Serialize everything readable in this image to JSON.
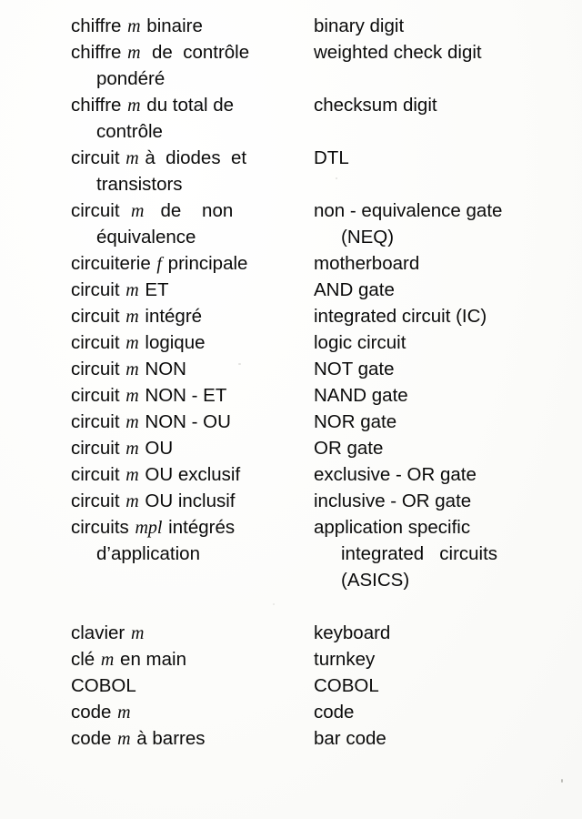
{
  "document": {
    "type": "bilingual-dictionary-page",
    "source_language": "French",
    "target_language": "English",
    "section_letter_range": "chiffre – code"
  },
  "entries": [
    {
      "fr_lines": [
        {
          "text": "chiffre ",
          "gender": "m",
          "after": " binaire",
          "indent": 0,
          "justify": false
        }
      ],
      "en_lines": [
        {
          "text": "binary digit",
          "indent": 0,
          "justify": false
        }
      ]
    },
    {
      "fr_lines": [
        {
          "text": "chiffre ",
          "gender": "m",
          "after": "  de  contrôle",
          "indent": 0,
          "justify": true
        },
        {
          "text": "pondéré",
          "indent": 1,
          "justify": false
        }
      ],
      "en_lines": [
        {
          "text": "weighted check digit",
          "indent": 0,
          "justify": false
        }
      ]
    },
    {
      "fr_lines": [
        {
          "text": "chiffre ",
          "gender": "m",
          "after": " du total de",
          "indent": 0,
          "justify": true
        },
        {
          "text": "contrôle",
          "indent": 1,
          "justify": false
        }
      ],
      "en_lines": [
        {
          "text": "checksum digit",
          "indent": 0,
          "justify": false
        }
      ]
    },
    {
      "fr_lines": [
        {
          "text": "circuit ",
          "gender": "m",
          "after": " à  diodes  et",
          "indent": 0,
          "justify": true
        },
        {
          "text": "transistors",
          "indent": 1,
          "justify": false
        }
      ],
      "en_lines": [
        {
          "text": "DTL",
          "indent": 0,
          "justify": false
        }
      ]
    },
    {
      "fr_lines": [
        {
          "text": "circuit  ",
          "gender": "m",
          "after": "   de    non",
          "indent": 0,
          "justify": true
        },
        {
          "text": "équivalence",
          "indent": 1,
          "justify": false
        }
      ],
      "en_lines": [
        {
          "text": "non - equivalence gate",
          "indent": 0,
          "justify": false
        },
        {
          "text": "(NEQ)",
          "indent": 2,
          "justify": false
        }
      ]
    },
    {
      "fr_lines": [
        {
          "text": "circuiterie ",
          "gender": "f",
          "after": " principale",
          "indent": 0,
          "justify": false
        }
      ],
      "en_lines": [
        {
          "text": "motherboard",
          "indent": 0,
          "justify": false
        }
      ]
    },
    {
      "fr_lines": [
        {
          "text": "circuit ",
          "gender": "m",
          "after": " ET",
          "indent": 0,
          "justify": false
        }
      ],
      "en_lines": [
        {
          "text": "AND gate",
          "indent": 0,
          "justify": false
        }
      ]
    },
    {
      "fr_lines": [
        {
          "text": "circuit ",
          "gender": "m",
          "after": " intégré",
          "indent": 0,
          "justify": false
        }
      ],
      "en_lines": [
        {
          "text": "integrated circuit (IC)",
          "indent": 0,
          "justify": false
        }
      ]
    },
    {
      "fr_lines": [
        {
          "text": "circuit ",
          "gender": "m",
          "after": " logique",
          "indent": 0,
          "justify": false
        }
      ],
      "en_lines": [
        {
          "text": "logic circuit",
          "indent": 0,
          "justify": false
        }
      ]
    },
    {
      "fr_lines": [
        {
          "text": "circuit ",
          "gender": "m",
          "after": " NON",
          "indent": 0,
          "justify": false
        }
      ],
      "en_lines": [
        {
          "text": "NOT gate",
          "indent": 0,
          "justify": false
        }
      ]
    },
    {
      "fr_lines": [
        {
          "text": "circuit ",
          "gender": "m",
          "after": " NON - ET",
          "indent": 0,
          "justify": false
        }
      ],
      "en_lines": [
        {
          "text": "NAND gate",
          "indent": 0,
          "justify": false
        }
      ]
    },
    {
      "fr_lines": [
        {
          "text": "circuit ",
          "gender": "m",
          "after": " NON - OU",
          "indent": 0,
          "justify": false
        }
      ],
      "en_lines": [
        {
          "text": "NOR gate",
          "indent": 0,
          "justify": false
        }
      ]
    },
    {
      "fr_lines": [
        {
          "text": "circuit ",
          "gender": "m",
          "after": " OU",
          "indent": 0,
          "justify": false
        }
      ],
      "en_lines": [
        {
          "text": "OR gate",
          "indent": 0,
          "justify": false
        }
      ]
    },
    {
      "fr_lines": [
        {
          "text": "circuit ",
          "gender": "m",
          "after": " OU exclusif",
          "indent": 0,
          "justify": false
        }
      ],
      "en_lines": [
        {
          "text": "exclusive - OR gate",
          "indent": 0,
          "justify": false
        }
      ]
    },
    {
      "fr_lines": [
        {
          "text": "circuit ",
          "gender": "m",
          "after": " OU inclusif",
          "indent": 0,
          "justify": false
        }
      ],
      "en_lines": [
        {
          "text": "inclusive - OR gate",
          "indent": 0,
          "justify": false
        }
      ]
    },
    {
      "fr_lines": [
        {
          "text": "circuits ",
          "gender": "mpl",
          "after": " intégrés",
          "indent": 0,
          "justify": true
        },
        {
          "text": "d’application",
          "indent": 1,
          "justify": false
        }
      ],
      "en_lines": [
        {
          "text": "application specific",
          "indent": 0,
          "justify": false
        },
        {
          "text": "integrated   circuits",
          "indent": 2,
          "justify": true
        },
        {
          "text": "(ASICS)",
          "indent": 2,
          "justify": false
        }
      ]
    },
    {
      "fr_lines": [
        {
          "text": "clavier ",
          "gender": "m",
          "after": "",
          "indent": 0,
          "justify": false
        }
      ],
      "en_lines": [
        {
          "text": "keyboard",
          "indent": 0,
          "justify": false
        }
      ],
      "gap_before": true
    },
    {
      "fr_lines": [
        {
          "text": "clé ",
          "gender": "m",
          "after": " en main",
          "indent": 0,
          "justify": false
        }
      ],
      "en_lines": [
        {
          "text": "turnkey",
          "indent": 0,
          "justify": false
        }
      ]
    },
    {
      "fr_lines": [
        {
          "text": "COBOL",
          "gender": "",
          "after": "",
          "indent": 0,
          "justify": false
        }
      ],
      "en_lines": [
        {
          "text": "COBOL",
          "indent": 0,
          "justify": false
        }
      ]
    },
    {
      "fr_lines": [
        {
          "text": "code ",
          "gender": "m",
          "after": "",
          "indent": 0,
          "justify": false
        }
      ],
      "en_lines": [
        {
          "text": "code",
          "indent": 0,
          "justify": false
        }
      ]
    },
    {
      "fr_lines": [
        {
          "text": "code ",
          "gender": "m",
          "after": " à barres",
          "indent": 0,
          "justify": false
        }
      ],
      "en_lines": [
        {
          "text": "bar code",
          "indent": 0,
          "justify": false
        }
      ]
    }
  ]
}
